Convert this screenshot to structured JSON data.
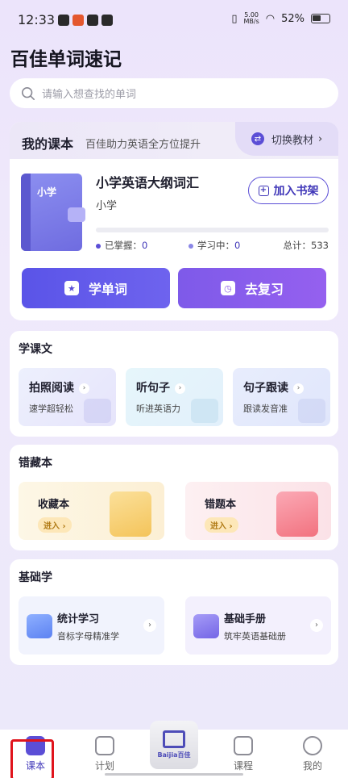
{
  "status_bar": {
    "time": "12:33",
    "speed_value": "5.00",
    "speed_unit": "MB/s",
    "battery": "52%"
  },
  "app": {
    "title": "百佳单词速记"
  },
  "search": {
    "placeholder": "请输入想查找的单词"
  },
  "my_book": {
    "title": "我的课本",
    "subtitle": "百佳助力英语全方位提升",
    "switch_label": "切换教材",
    "cover_label": "小学",
    "book_name": "小学英语大纲词汇",
    "level": "小学",
    "add_shelf_label": "加入书架",
    "progress_fraction": 0,
    "mastered_label": "已掌握：",
    "mastered_value": "0",
    "learning_label": "学习中：",
    "learning_value": "0",
    "total_label": "总计：",
    "total_value": "533",
    "learn_button": "学单词",
    "review_button": "去复习"
  },
  "learn_text": {
    "title": "学课文",
    "cards": [
      {
        "title": "拍照阅读",
        "subtitle": "速学超轻松"
      },
      {
        "title": "听句子",
        "subtitle": "听进英语力"
      },
      {
        "title": "句子跟读",
        "subtitle": "跟读发音准"
      }
    ]
  },
  "collections": {
    "title": "错藏本",
    "cards": [
      {
        "title": "收藏本",
        "enter": "进入"
      },
      {
        "title": "错题本",
        "enter": "进入"
      }
    ]
  },
  "basics": {
    "title": "基础学",
    "cards": [
      {
        "title": "统计学习",
        "subtitle": "音标字母精准学"
      },
      {
        "title": "基础手册",
        "subtitle": "筑牢英语基础册"
      }
    ]
  },
  "nav": {
    "items": [
      {
        "label": "课本"
      },
      {
        "label": "计划"
      },
      {
        "label": "课程"
      },
      {
        "label": "我的"
      }
    ],
    "logo_text": "Baijia百佳"
  },
  "colors": {
    "accent": "#5b4ed6",
    "highlight": "#e0141c"
  }
}
